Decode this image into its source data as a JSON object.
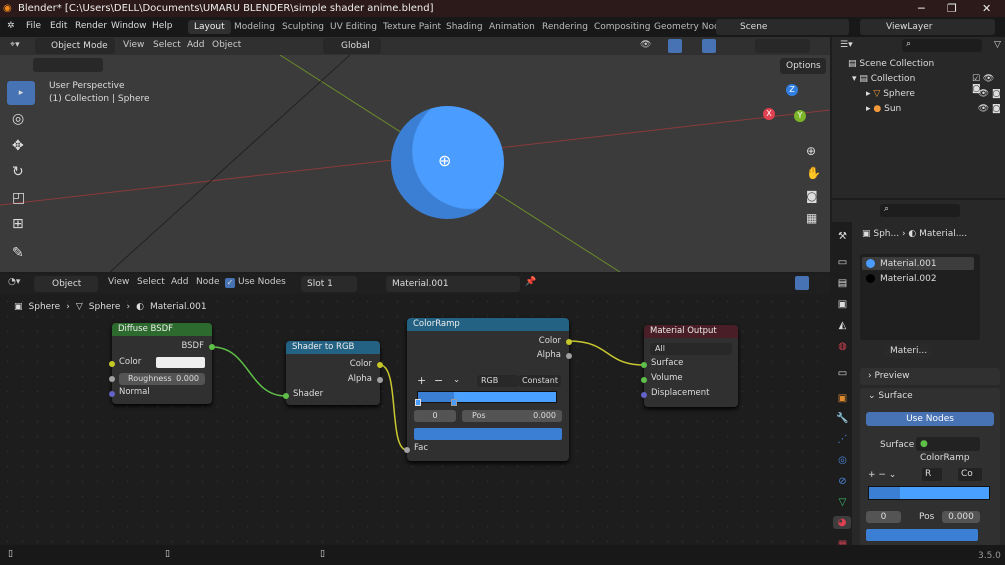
{
  "window": {
    "title": "Blender* [C:\\Users\\DELL\\Documents\\UMARU BLENDER\\simple shader anime.blend]",
    "minimize": "─",
    "maximize": "❐",
    "close": "✕"
  },
  "menu": [
    "File",
    "Edit",
    "Render",
    "Window",
    "Help"
  ],
  "workspaces": [
    "Layout",
    "Modeling",
    "Sculpting",
    "UV Editing",
    "Texture Paint",
    "Shading",
    "Animation",
    "Rendering",
    "Compositing",
    "Geometry Noc"
  ],
  "scene": "Scene",
  "view_layer": "ViewLayer",
  "viewport": {
    "mode": "Object Mode",
    "menus": [
      "View",
      "Select",
      "Add",
      "Object"
    ],
    "orientation": "Global",
    "options": "Options",
    "perspective": "User Perspective",
    "context": "(1) Collection | Sphere",
    "axes": {
      "x": "X",
      "y": "Y",
      "z": "Z"
    },
    "sphere_color": "#4a9cff"
  },
  "node_editor": {
    "type": "Object",
    "menus": [
      "View",
      "Select",
      "Add",
      "Node"
    ],
    "use_nodes": "Use Nodes",
    "slot": "Slot 1",
    "material": "Material.001",
    "breadcrumb": [
      "Sphere",
      "Sphere",
      "Material.001"
    ],
    "nodes": {
      "diffuse": {
        "title": "Diffuse BSDF",
        "out": "BSDF",
        "color": "Color",
        "roughness_label": "Roughness",
        "roughness": "0.000",
        "normal": "Normal"
      },
      "shader_rgb": {
        "title": "Shader to RGB",
        "color": "Color",
        "alpha": "Alpha",
        "shader": "Shader"
      },
      "colorramp": {
        "title": "ColorRamp",
        "color": "Color",
        "alpha": "Alpha",
        "plus": "+",
        "minus": "−",
        "mode": "RGB",
        "interp": "Constant",
        "index": "0",
        "pos_label": "Pos",
        "pos": "0.000",
        "fac": "Fac"
      },
      "output": {
        "title": "Material Output",
        "target": "All",
        "surface": "Surface",
        "volume": "Volume",
        "displacement": "Displacement"
      }
    }
  },
  "outliner": {
    "root": "Scene Collection",
    "items": [
      "Collection",
      "Sphere",
      "Sun"
    ]
  },
  "properties": {
    "breadcrumb": [
      "Sph...",
      "Material...."
    ],
    "materials": [
      {
        "name": "Material.001",
        "color": "#4a9cff"
      },
      {
        "name": "Material.002",
        "color": "#000000"
      }
    ],
    "material_field": "Materi...",
    "preview": "Preview",
    "surface_panel": "Surface",
    "use_nodes": "Use Nodes",
    "surface_label": "Surface",
    "surface_value": "ColorRamp",
    "mode": "R",
    "interp": "Co",
    "index": "0",
    "pos_label": "Pos",
    "pos": "0.000"
  },
  "status": {
    "version": "3.5.0"
  }
}
